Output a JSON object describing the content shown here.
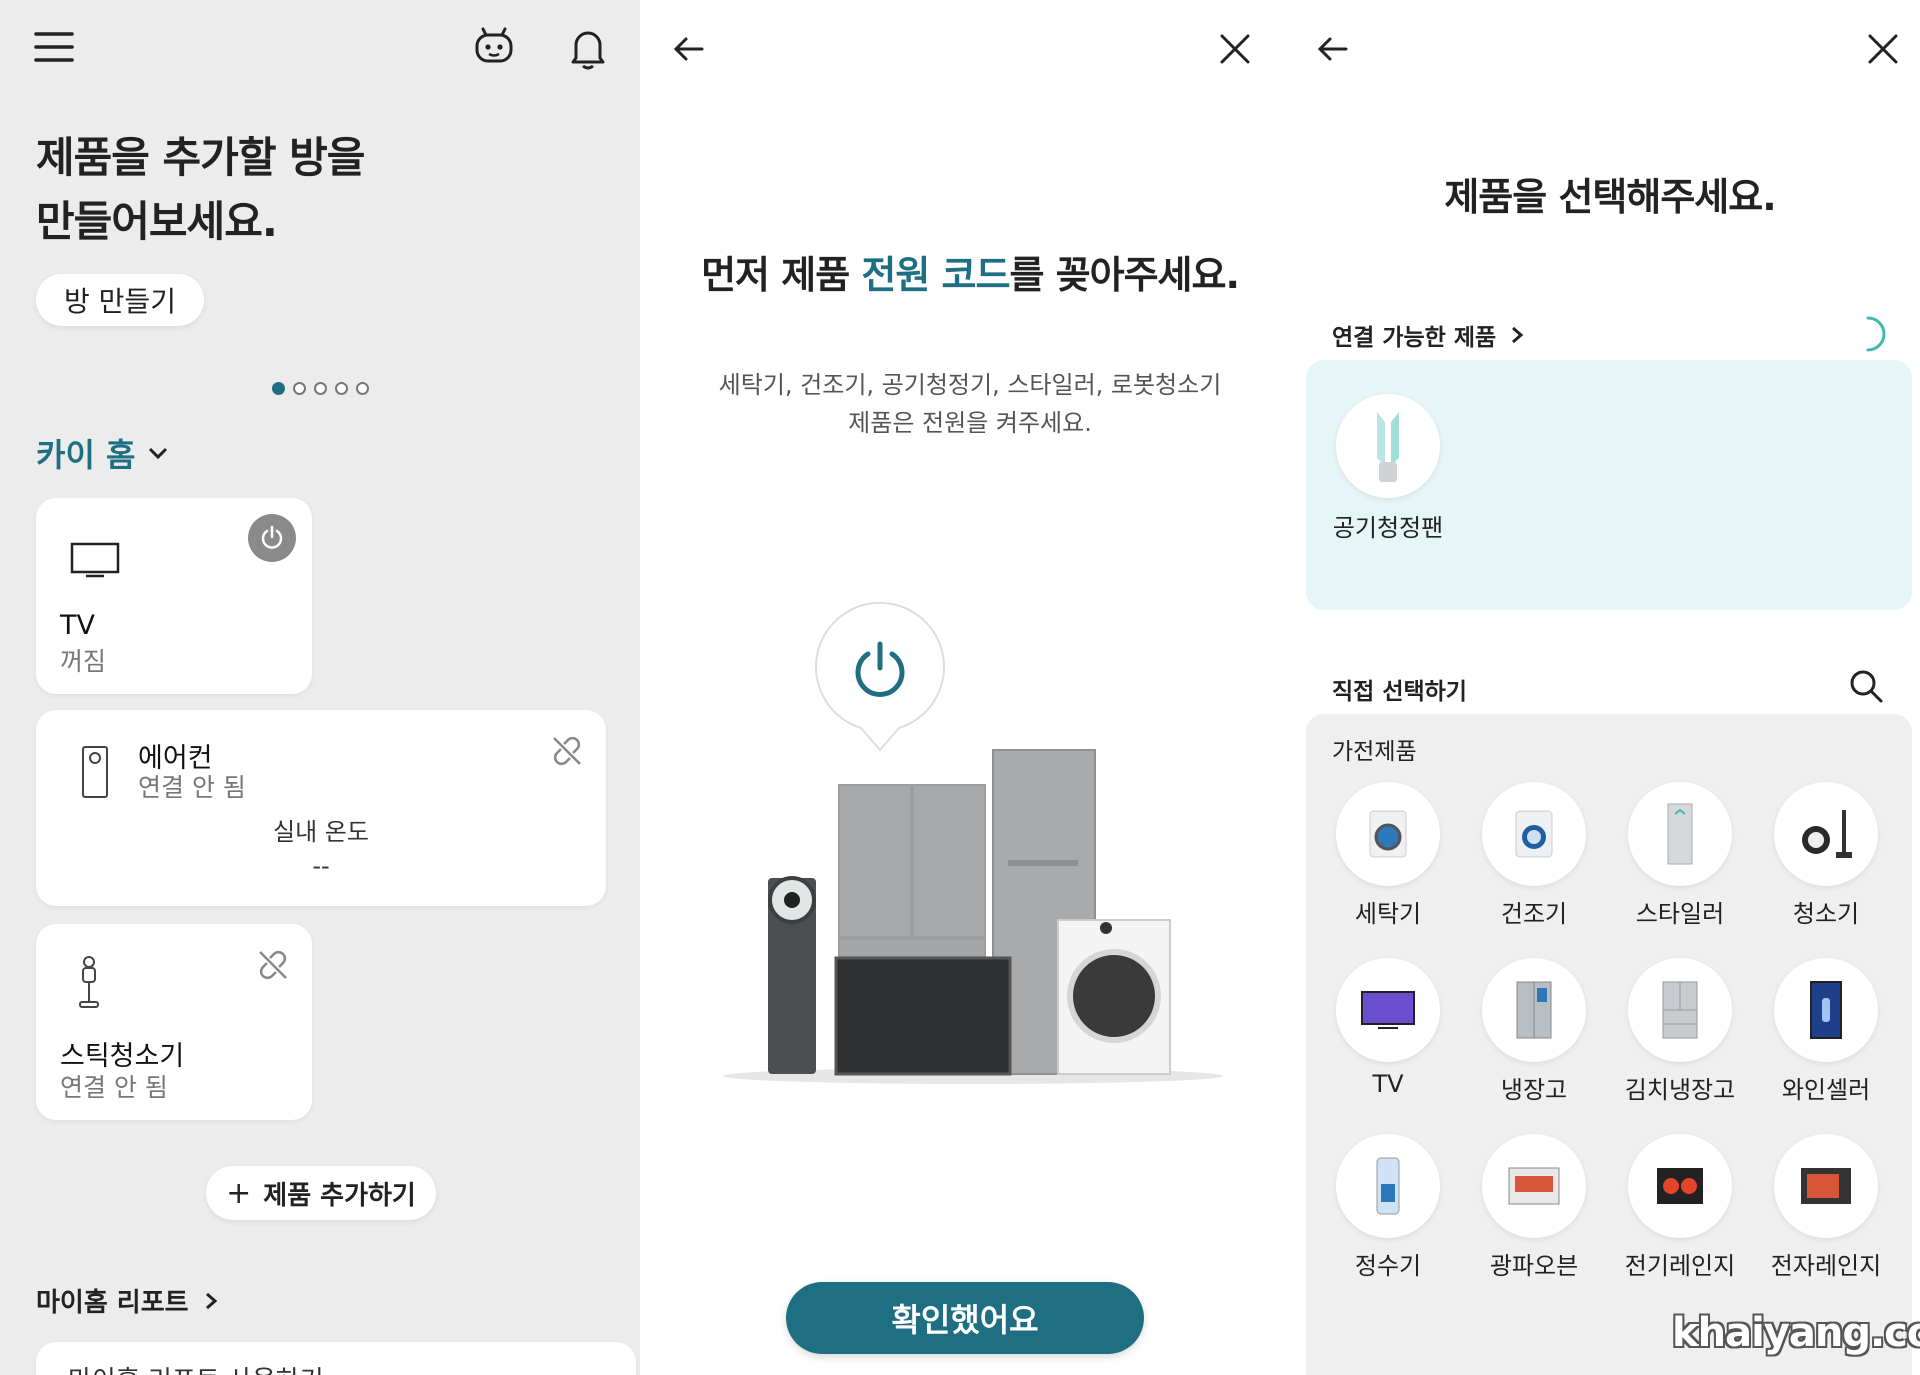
{
  "left": {
    "title_line1": "제품을 추가할 방을",
    "title_line2": "만들어보세요.",
    "make_room": "방 만들기",
    "home_name": "카이 홈",
    "carousel": {
      "count": 5,
      "active": 0
    },
    "devices": [
      {
        "name": "TV",
        "status": "꺼짐"
      },
      {
        "name": "에어컨",
        "status": "연결 안 됨",
        "sub_label": "실내 온도",
        "sub_value": "--"
      },
      {
        "name": "스틱청소기",
        "status": "연결 안 됨"
      }
    ],
    "add_product": "제품 추가하기",
    "report_title": "마이홈 리포트",
    "report_item": "마이홈 리포트 사용하기"
  },
  "middle": {
    "title_pre": "먼저 제품 ",
    "title_highlight": "전원 코드",
    "title_post": "를 꽂아주세요.",
    "desc_line1": "세탁기, 건조기, 공기청정기, 스타일러, 로봇청소기",
    "desc_line2": "제품은 전원을 켜주세요.",
    "confirm": "확인했어요",
    "accent_color": "#1f6f83"
  },
  "right": {
    "title": "제품을 선택해주세요.",
    "connectable_label": "연결 가능한 제품",
    "connectable_item": "공기청정팬",
    "direct_label": "직접 선택하기",
    "category": "가전제품",
    "products": [
      "세탁기",
      "건조기",
      "스타일러",
      "청소기",
      "TV",
      "냉장고",
      "김치냉장고",
      "와인셀러",
      "정수기",
      "광파오븐",
      "전기레인지",
      "전자레인지"
    ],
    "watermark": "khaiyang.com"
  }
}
